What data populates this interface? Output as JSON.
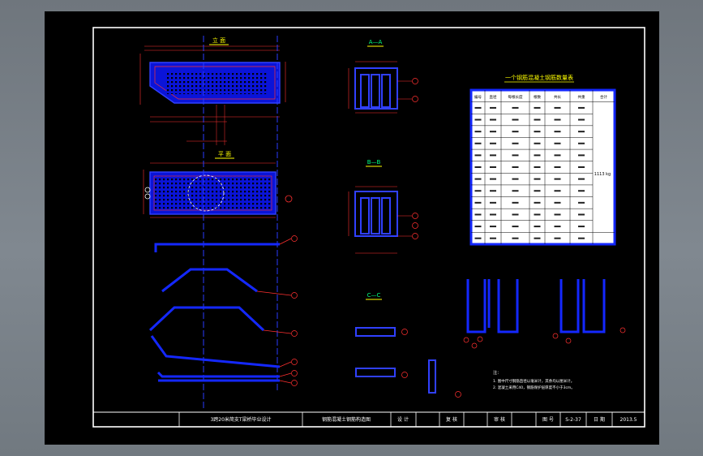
{
  "drawing": {
    "views": {
      "elevation": "立 面",
      "plan": "平 面",
      "section_a": "A—A",
      "section_b": "B—B",
      "section_c": "C—C"
    },
    "table": {
      "title": "一个钢筋混凝土钢筋数量表",
      "header_cells": [
        "编号",
        "直径",
        "每根长度",
        "根数",
        "共长",
        "共重",
        "合计"
      ],
      "total_label": "1113 kg"
    },
    "notes": {
      "heading": "注：",
      "line1": "1. 图中尺寸钢筋直径以毫米计，其余均以厘米计。",
      "line2": "2. 混凝土采用C40，钢筋保护层厚度不小于3cm。"
    },
    "title_block": {
      "project": "3跨20米简支T梁桥毕业设计",
      "drawing_name": "钢筋混凝土钢筋构造图",
      "designed_label": "设 计",
      "checked_label": "复 核",
      "approved_label": "审 核",
      "drawing_no_label": "图 号",
      "drawing_no": "S-2-37",
      "date_label": "日 期",
      "date": "2013.5"
    }
  }
}
